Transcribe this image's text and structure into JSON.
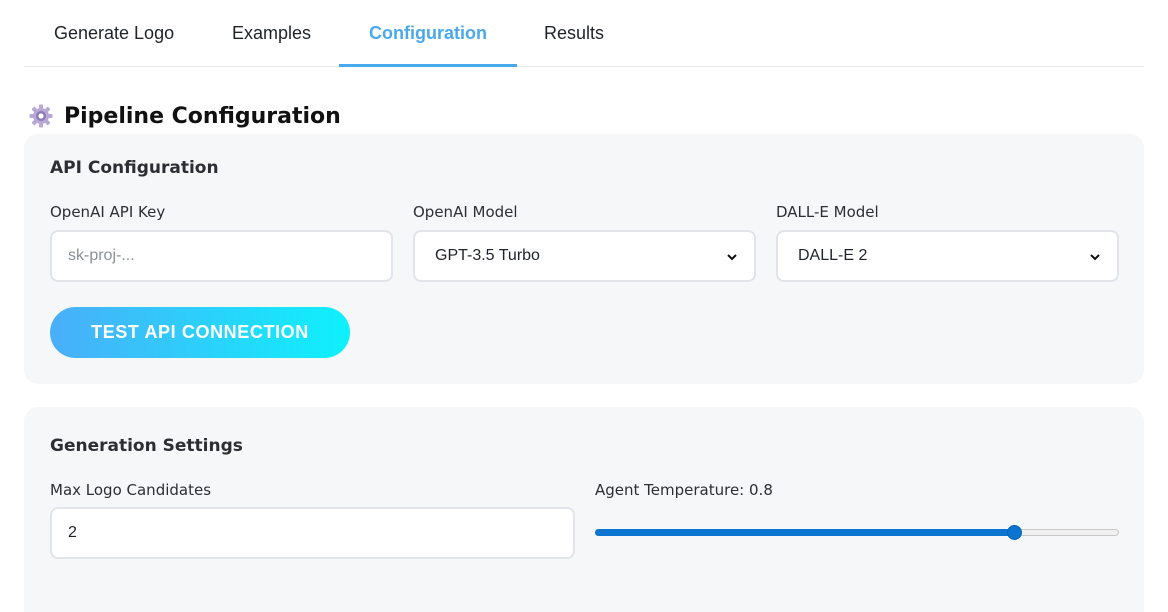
{
  "tabs": [
    {
      "label": "Generate Logo",
      "active": false
    },
    {
      "label": "Examples",
      "active": false
    },
    {
      "label": "Configuration",
      "active": true
    },
    {
      "label": "Results",
      "active": false
    }
  ],
  "section": {
    "icon": "gear-icon",
    "title": "Pipeline Configuration"
  },
  "api_config": {
    "title": "API Configuration",
    "api_key": {
      "label": "OpenAI API Key",
      "value": "",
      "placeholder": "sk-proj-..."
    },
    "openai_model": {
      "label": "OpenAI Model",
      "selected": "GPT-3.5 Turbo"
    },
    "dalle_model": {
      "label": "DALL-E Model",
      "selected": "DALL-E 2"
    },
    "test_button": "TEST API CONNECTION"
  },
  "generation": {
    "title": "Generation Settings",
    "max_candidates": {
      "label": "Max Logo Candidates",
      "value": "2"
    },
    "temperature": {
      "label": "Agent Temperature: 0.8",
      "value": 0.8,
      "fraction": 0.8
    }
  },
  "colors": {
    "accent": "#4aa8ec",
    "button_gradient_start": "#4aaef9",
    "button_gradient_end": "#0ef1fd",
    "slider": "#0a74d0",
    "card_bg": "#f6f7f9"
  }
}
